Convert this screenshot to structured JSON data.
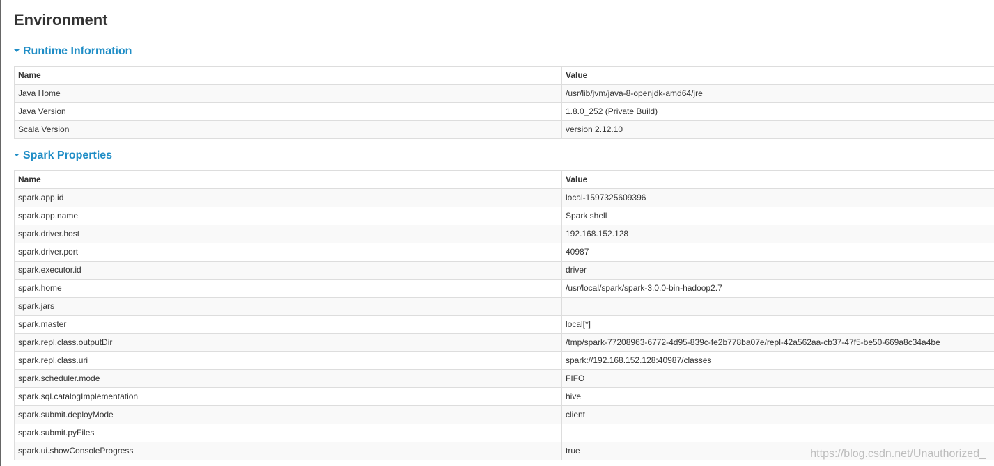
{
  "page": {
    "title": "Environment"
  },
  "runtime": {
    "header": "Runtime Information",
    "columns": {
      "name": "Name",
      "value": "Value"
    },
    "rows": [
      {
        "name": "Java Home",
        "value": "/usr/lib/jvm/java-8-openjdk-amd64/jre"
      },
      {
        "name": "Java Version",
        "value": "1.8.0_252 (Private Build)"
      },
      {
        "name": "Scala Version",
        "value": "version 2.12.10"
      }
    ]
  },
  "spark": {
    "header": "Spark Properties",
    "columns": {
      "name": "Name",
      "value": "Value"
    },
    "rows": [
      {
        "name": "spark.app.id",
        "value": "local-1597325609396"
      },
      {
        "name": "spark.app.name",
        "value": "Spark shell"
      },
      {
        "name": "spark.driver.host",
        "value": "192.168.152.128"
      },
      {
        "name": "spark.driver.port",
        "value": "40987"
      },
      {
        "name": "spark.executor.id",
        "value": "driver"
      },
      {
        "name": "spark.home",
        "value": "/usr/local/spark/spark-3.0.0-bin-hadoop2.7"
      },
      {
        "name": "spark.jars",
        "value": ""
      },
      {
        "name": "spark.master",
        "value": "local[*]"
      },
      {
        "name": "spark.repl.class.outputDir",
        "value": "/tmp/spark-77208963-6772-4d95-839c-fe2b778ba07e/repl-42a562aa-cb37-47f5-be50-669a8c34a4be"
      },
      {
        "name": "spark.repl.class.uri",
        "value": "spark://192.168.152.128:40987/classes"
      },
      {
        "name": "spark.scheduler.mode",
        "value": "FIFO"
      },
      {
        "name": "spark.sql.catalogImplementation",
        "value": "hive"
      },
      {
        "name": "spark.submit.deployMode",
        "value": "client"
      },
      {
        "name": "spark.submit.pyFiles",
        "value": ""
      },
      {
        "name": "spark.ui.showConsoleProgress",
        "value": "true"
      }
    ]
  },
  "watermark": "https://blog.csdn.net/Unauthorized_",
  "colors": {
    "section_header": "#1f8dc6",
    "table_border": "#dddddd",
    "stripe": "#f9f9f9"
  }
}
